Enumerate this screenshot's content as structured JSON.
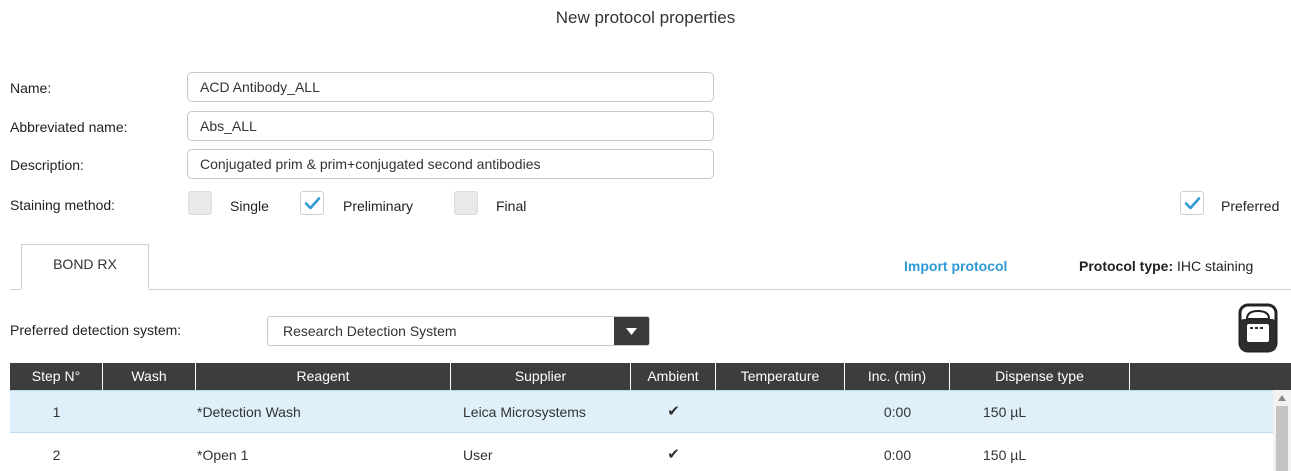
{
  "title": "New protocol properties",
  "fields": {
    "name_label": "Name:",
    "name_value": "ACD Antibody_ALL",
    "abbrev_label": "Abbreviated name:",
    "abbrev_value": "Abs_ALL",
    "desc_label": "Description:",
    "desc_value": "Conjugated prim & prim+conjugated second antibodies"
  },
  "staining": {
    "label": "Staining method:",
    "options": [
      {
        "label": "Single",
        "checked": false
      },
      {
        "label": "Preliminary",
        "checked": true
      },
      {
        "label": "Final",
        "checked": false
      }
    ],
    "preferred": {
      "label": "Preferred",
      "checked": true
    }
  },
  "tabs": [
    {
      "label": "BOND RX",
      "active": true
    }
  ],
  "import_label": "Import protocol",
  "protocol_type": {
    "label": "Protocol type:",
    "value": "IHC staining"
  },
  "detection": {
    "label": "Preferred detection system:",
    "value": "Research Detection System"
  },
  "table": {
    "columns": [
      "Step N°",
      "Wash",
      "Reagent",
      "Supplier",
      "Ambient",
      "Temperature",
      "Inc. (min)",
      "Dispense type"
    ],
    "rows": [
      {
        "step": "1",
        "wash": "",
        "reagent": "*Detection Wash",
        "supplier": "Leica Microsystems",
        "ambient": "✔",
        "temperature": "",
        "inc": "0:00",
        "dispense": "150 µL",
        "selected": true
      },
      {
        "step": "2",
        "wash": "",
        "reagent": "*Open 1",
        "supplier": "User",
        "ambient": "✔",
        "temperature": "",
        "inc": "0:00",
        "dispense": "150 µL",
        "selected": false
      }
    ]
  },
  "colors": {
    "accent": "#2f9ad6",
    "header_bg": "#3d3d3d",
    "selected_row": "#dff0fa"
  }
}
